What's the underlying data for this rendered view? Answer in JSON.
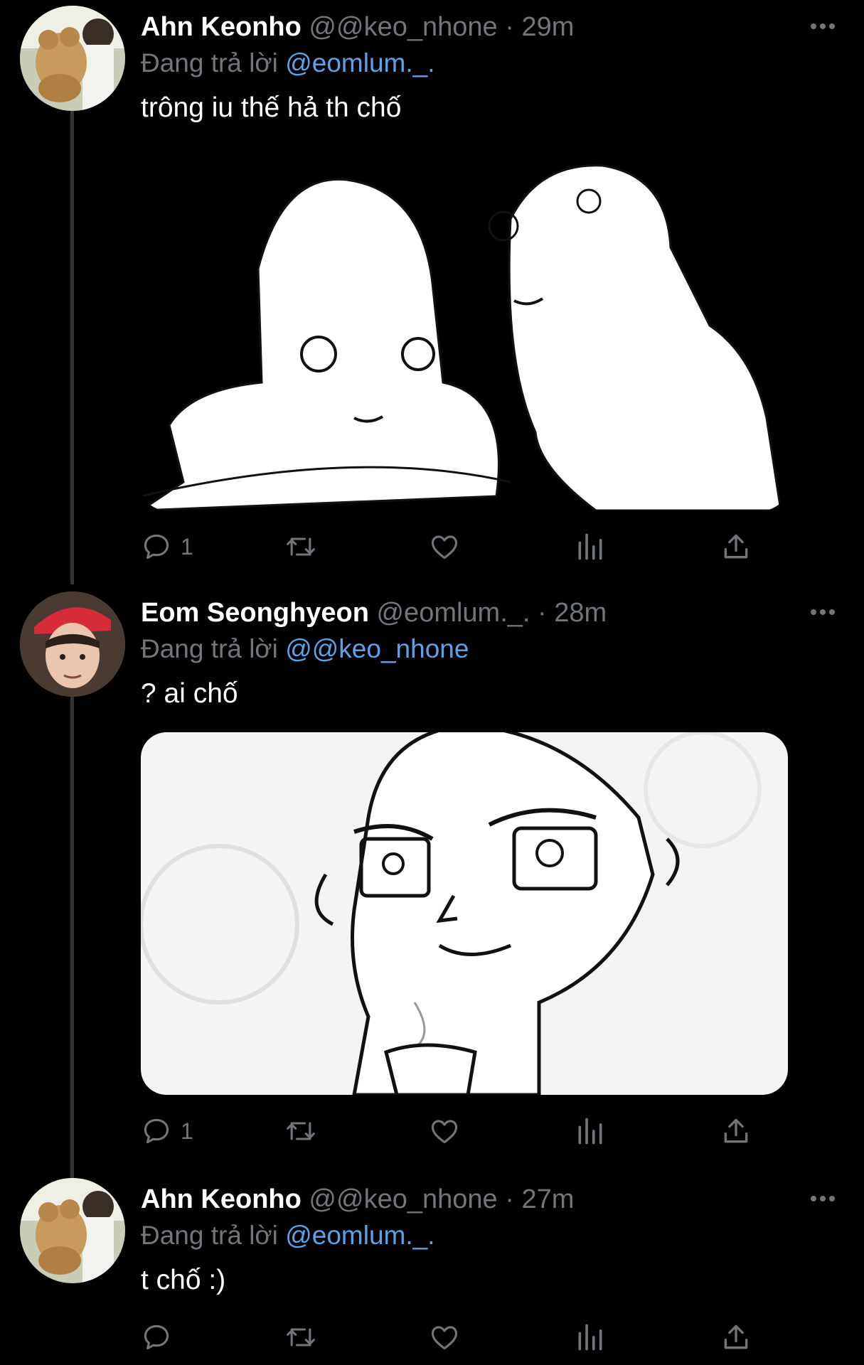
{
  "tweets": [
    {
      "name": "Ahn Keonho",
      "handle": "@@keo_nhone",
      "separator": "·",
      "time": "29m",
      "reply_prefix": "Đang trả lời",
      "reply_target": "@eomlum._.",
      "text": "trông iu thế hả th chố",
      "has_media": true,
      "reply_count": "1"
    },
    {
      "name": "Eom Seonghyeon",
      "handle": "@eomlum._.",
      "separator": "·",
      "time": "28m",
      "reply_prefix": "Đang trả lời",
      "reply_target": "@@keo_nhone",
      "text": "? ai chố",
      "has_media": true,
      "reply_count": "1"
    },
    {
      "name": "Ahn Keonho",
      "handle": "@@keo_nhone",
      "separator": "·",
      "time": "27m",
      "reply_prefix": "Đang trả lời",
      "reply_target": "@eomlum._.",
      "text": "t chố :)",
      "has_media": false,
      "reply_count": ""
    }
  ],
  "icons": {
    "more": "more-horizontal-icon",
    "reply": "reply-bubble-icon",
    "retweet": "retweet-icon",
    "like": "heart-icon",
    "views": "analytics-bars-icon",
    "share": "share-upload-icon"
  },
  "colors": {
    "background": "#000000",
    "name": "#ffffff",
    "muted": "#71767b",
    "link": "#5aa3e8",
    "thread_line": "#333639"
  }
}
